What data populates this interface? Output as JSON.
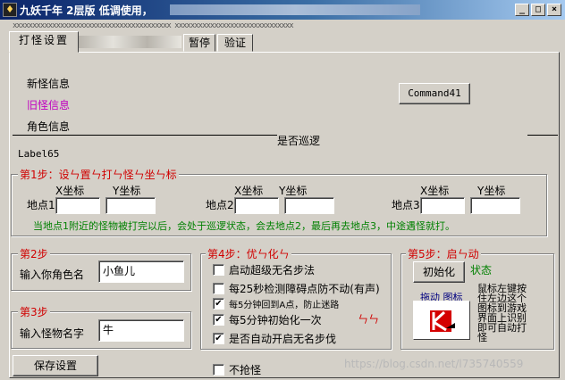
{
  "window": {
    "title": "九妖千年 2层版 低调使用，",
    "min": "_",
    "max": "□",
    "close": "×"
  },
  "tabs": [
    {
      "label": "打怪设置"
    },
    {
      "label": "暂停"
    },
    {
      "label": "验证"
    }
  ],
  "tab_strip_text": "xxxxxxxxxxxxxxxxxxxxxxxxxxxxxxxxxxxxxxxx xxxxxxxxxxxxxxxxxxxxxxxxxxxxxx",
  "info": {
    "new_monster": "新怪信息",
    "old_monster": "旧怪信息",
    "role": "角色信息",
    "patrol_status": "是否巡逻",
    "label65": "Label65",
    "command41": "Command41"
  },
  "step1": {
    "legend": "第1步：设ㄣ置ㄣ打ㄣ怪ㄣ坐ㄣ标",
    "x_label": "X坐标",
    "y_label": "Y坐标",
    "point1": "地点1",
    "point2": "地点2",
    "point3": "地点3",
    "note": "当地点1附近的怪物被打完以后，会处于巡逻状态，会去地点2，最后再去地点3，中途遇怪就打。"
  },
  "step2": {
    "legend": "第2步",
    "label": "输入你角色名",
    "value": "小鱼儿"
  },
  "step3": {
    "legend": "第3步",
    "label": "输入怪物名字",
    "value": "牛"
  },
  "save_button": "保存设置",
  "step4": {
    "legend": "第4步：优ㄣ化ㄣ",
    "options": [
      {
        "label": "启动超级无名步法",
        "checked": false
      },
      {
        "label": "每25秒检测障碍点防不动(有声)",
        "checked": false
      },
      {
        "label": "每5分钟回到A点，防止迷路",
        "checked": true
      },
      {
        "label": "每5分钟初始化一次",
        "checked": true
      },
      {
        "label": "是否自动开启无名步伐",
        "checked": true
      }
    ],
    "deco": "ㄣㄣ"
  },
  "no_grab": {
    "label": "不抢怪",
    "checked": false
  },
  "step5": {
    "legend": "第5步：启ㄣ动",
    "init_button": "初始化",
    "status": "状态",
    "drag_icon_label": "拖动 图标",
    "instructions": "鼠标左键按住左边这个图标到游戏界面上识别即可自动打怪"
  },
  "watermark": "https://blog.csdn.net/l735740559",
  "colors": {
    "purple": "#c000c0",
    "red": "#d00000",
    "green": "#008000",
    "navy": "#000080"
  }
}
